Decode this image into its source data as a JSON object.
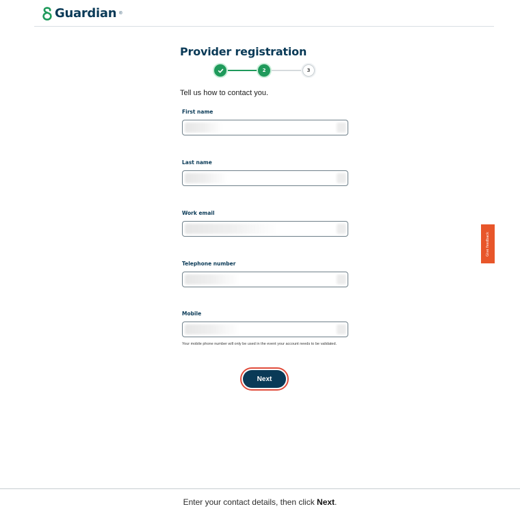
{
  "brand": {
    "name": "Guardian",
    "trademark": "®",
    "color": "#0a3a57",
    "logo_icon": "guardian-g-icon"
  },
  "page": {
    "title": "Provider registration",
    "intro": "Tell us how to contact you."
  },
  "stepper": {
    "steps": [
      {
        "label": "1",
        "state": "done",
        "icon": "check-icon"
      },
      {
        "label": "2",
        "state": "current"
      },
      {
        "label": "3",
        "state": "todo"
      }
    ],
    "active_color": "#1f9a5b"
  },
  "form": {
    "fields": [
      {
        "label": "First name",
        "value": ""
      },
      {
        "label": "Last name",
        "value": ""
      },
      {
        "label": "Work email",
        "value": ""
      },
      {
        "label": "Telephone number",
        "value": ""
      },
      {
        "label": "Mobile",
        "value": ""
      }
    ],
    "mobile_helper": "Your mobile phone number will only be used in the event your account needs to be validated.",
    "next_label": "Next"
  },
  "feedback": {
    "label": "Give feedback",
    "color": "#e8562a"
  },
  "instruction": {
    "text_before": "Enter your contact details, then click ",
    "text_bold": "Next",
    "text_after": "."
  }
}
